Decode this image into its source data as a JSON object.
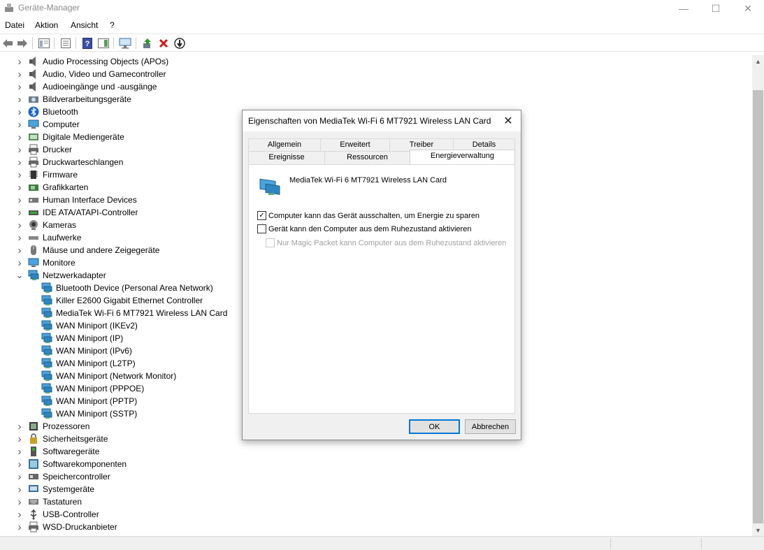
{
  "window": {
    "title": "Geräte-Manager",
    "controls": {
      "minimize": "—",
      "maximize": "☐",
      "close": "✕"
    }
  },
  "menu": [
    "Datei",
    "Aktion",
    "Ansicht",
    "?"
  ],
  "toolbar": {
    "icons": [
      "back-arrow-icon",
      "forward-arrow-icon",
      "show-hide-tree-icon",
      "properties-icon",
      "help-icon",
      "action-pane-icon",
      "monitor-icon",
      "update-driver-icon",
      "uninstall-icon",
      "disable-device-icon"
    ],
    "colors": {
      "uninstall": "#d11919",
      "update": "#2a9a2a"
    }
  },
  "tree": {
    "categories": [
      {
        "label": "Audio Processing Objects (APOs)",
        "icon": "speaker-icon"
      },
      {
        "label": "Audio, Video und Gamecontroller",
        "icon": "speaker-icon"
      },
      {
        "label": "Audioeingänge und -ausgänge",
        "icon": "speaker-icon"
      },
      {
        "label": "Bildverarbeitungsgeräte",
        "icon": "camera-icon"
      },
      {
        "label": "Bluetooth",
        "icon": "bluetooth-icon"
      },
      {
        "label": "Computer",
        "icon": "computer-icon"
      },
      {
        "label": "Digitale Mediengeräte",
        "icon": "media-device-icon"
      },
      {
        "label": "Drucker",
        "icon": "printer-icon"
      },
      {
        "label": "Druckwarteschlangen",
        "icon": "printer-icon"
      },
      {
        "label": "Firmware",
        "icon": "chip-icon"
      },
      {
        "label": "Grafikkarten",
        "icon": "display-adapter-icon"
      },
      {
        "label": "Human Interface Devices",
        "icon": "hid-icon"
      },
      {
        "label": "IDE ATA/ATAPI-Controller",
        "icon": "ide-icon"
      },
      {
        "label": "Kameras",
        "icon": "webcam-icon"
      },
      {
        "label": "Laufwerke",
        "icon": "drive-icon"
      },
      {
        "label": "Mäuse und andere Zeigegeräte",
        "icon": "mouse-icon"
      },
      {
        "label": "Monitore",
        "icon": "monitor-icon"
      },
      {
        "label": "Netzwerkadapter",
        "icon": "network-icon",
        "expanded": true
      }
    ],
    "network_children": [
      "Bluetooth Device (Personal Area Network)",
      "Killer E2600 Gigabit Ethernet Controller",
      "MediaTek Wi-Fi 6 MT7921 Wireless LAN Card",
      "WAN Miniport (IKEv2)",
      "WAN Miniport (IP)",
      "WAN Miniport (IPv6)",
      "WAN Miniport (L2TP)",
      "WAN Miniport (Network Monitor)",
      "WAN Miniport (PPPOE)",
      "WAN Miniport (PPTP)",
      "WAN Miniport (SSTP)"
    ],
    "categories_after": [
      {
        "label": "Prozessoren",
        "icon": "processor-icon"
      },
      {
        "label": "Sicherheitsgeräte",
        "icon": "security-icon"
      },
      {
        "label": "Softwaregeräte",
        "icon": "software-device-icon"
      },
      {
        "label": "Softwarekomponenten",
        "icon": "software-component-icon"
      },
      {
        "label": "Speichercontroller",
        "icon": "storage-controller-icon"
      },
      {
        "label": "Systemgeräte",
        "icon": "system-device-icon"
      },
      {
        "label": "Tastaturen",
        "icon": "keyboard-icon"
      },
      {
        "label": "USB-Controller",
        "icon": "usb-icon"
      },
      {
        "label": "WSD-Druckanbieter",
        "icon": "printer-icon"
      }
    ]
  },
  "dialog": {
    "title": "Eigenschaften von MediaTek Wi-Fi 6 MT7921 Wireless LAN Card",
    "tabs_row1": [
      "Allgemein",
      "Erweitert",
      "Treiber",
      "Details"
    ],
    "tabs_row2": [
      "Ereignisse",
      "Ressourcen",
      "Energieverwaltung"
    ],
    "active_tab": "Energieverwaltung",
    "device_name": "MediaTek Wi-Fi 6 MT7921 Wireless LAN Card",
    "options": [
      {
        "label": "Computer kann das Gerät ausschalten, um Energie zu sparen",
        "checked": true,
        "enabled": true
      },
      {
        "label": "Gerät kann den Computer aus dem Ruhezustand aktivieren",
        "checked": false,
        "enabled": true
      },
      {
        "label": "Nur Magic Packet kann Computer aus dem Ruhezustand aktivieren",
        "checked": false,
        "enabled": false
      }
    ],
    "ok_label": "OK",
    "cancel_label": "Abbrechen",
    "accent_color": "#0078d7"
  }
}
